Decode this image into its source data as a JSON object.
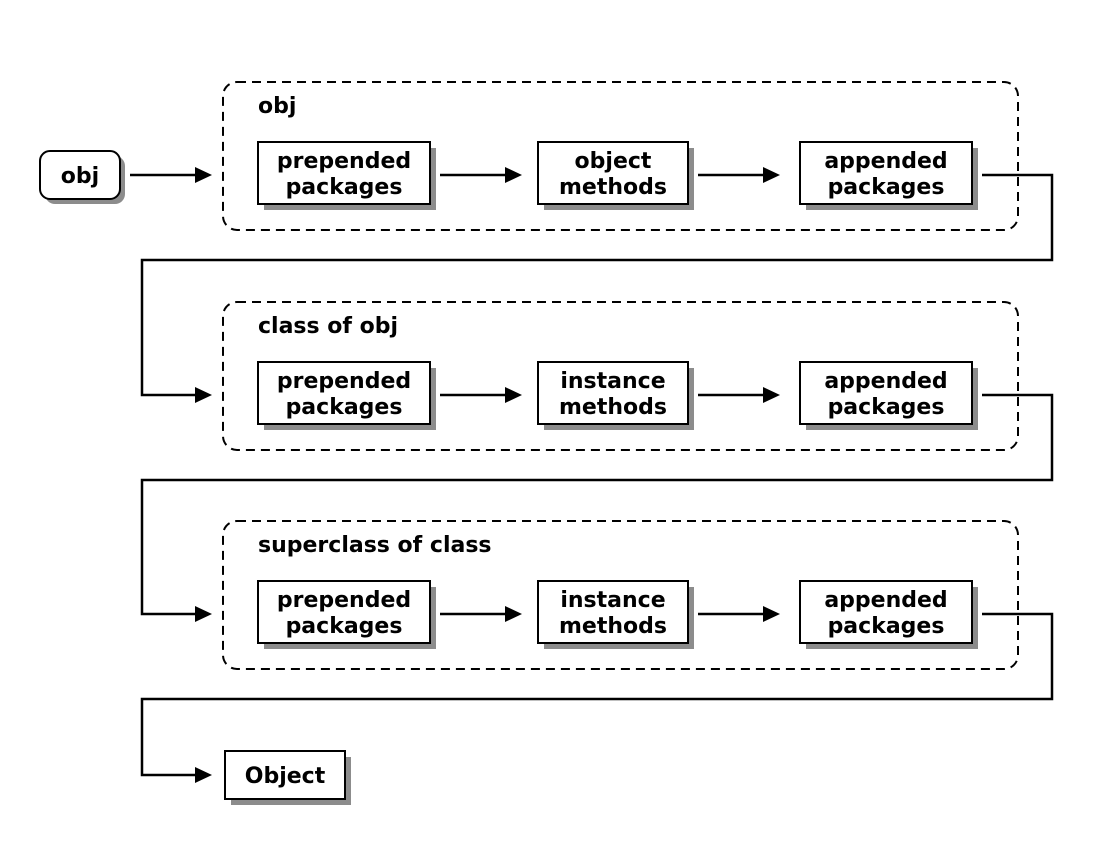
{
  "nodes": {
    "start": {
      "label": "obj"
    },
    "end": {
      "label": "Object"
    }
  },
  "groups": [
    {
      "title": "obj",
      "left": {
        "l1": "prepended",
        "l2": "packages"
      },
      "mid": {
        "l1": "object",
        "l2": "methods"
      },
      "right": {
        "l1": "appended",
        "l2": "packages"
      }
    },
    {
      "title": "class of obj",
      "left": {
        "l1": "prepended",
        "l2": "packages"
      },
      "mid": {
        "l1": "instance",
        "l2": "methods"
      },
      "right": {
        "l1": "appended",
        "l2": "packages"
      }
    },
    {
      "title": "superclass of class",
      "left": {
        "l1": "prepended",
        "l2": "packages"
      },
      "mid": {
        "l1": "instance",
        "l2": "methods"
      },
      "right": {
        "l1": "appended",
        "l2": "packages"
      }
    }
  ]
}
